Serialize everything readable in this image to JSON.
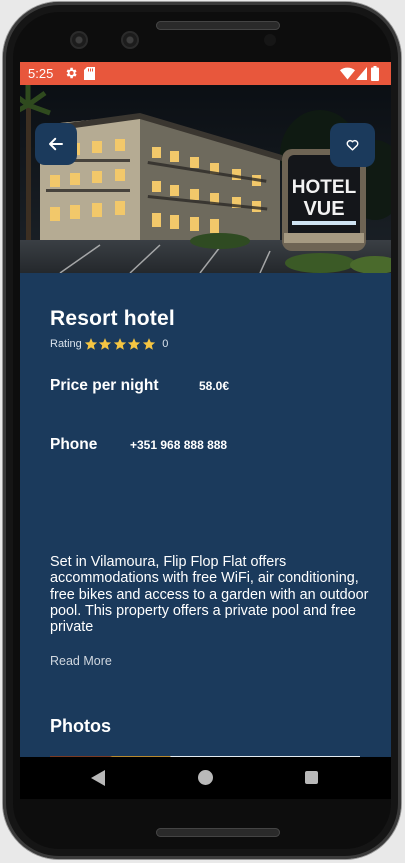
{
  "status_bar": {
    "time": "5:25",
    "icons": [
      "gear-icon",
      "sd-card-icon",
      "wifi-icon",
      "signal-icon",
      "battery-icon"
    ],
    "color": "#e8573c"
  },
  "hero": {
    "sign_text_line1": "HOTEL",
    "sign_text_line2": "VUE",
    "back_icon": "arrow-left-icon",
    "favorite_icon": "heart-outline-icon"
  },
  "hotel": {
    "name": "Resort hotel",
    "rating_label": "Rating",
    "stars": 5,
    "rating_count": "0",
    "price_label": "Price per night",
    "price_value": "58.0€",
    "phone_label": "Phone",
    "phone_value": "+351 968 888 888",
    "description": "Set in Vilamoura, Flip Flop Flat offers accommodations with free WiFi, air conditioning, free bikes and access to a garden with an outdoor pool. This property offers a private pool and free private",
    "read_more": "Read More",
    "photos_title": "Photos"
  },
  "navigation": {
    "back": "nav-back-triangle",
    "home": "nav-home-circle",
    "recents": "nav-recents-square"
  },
  "colors": {
    "background": "#1b3a5c",
    "star": "#f5c542",
    "text": "#ffffff"
  }
}
